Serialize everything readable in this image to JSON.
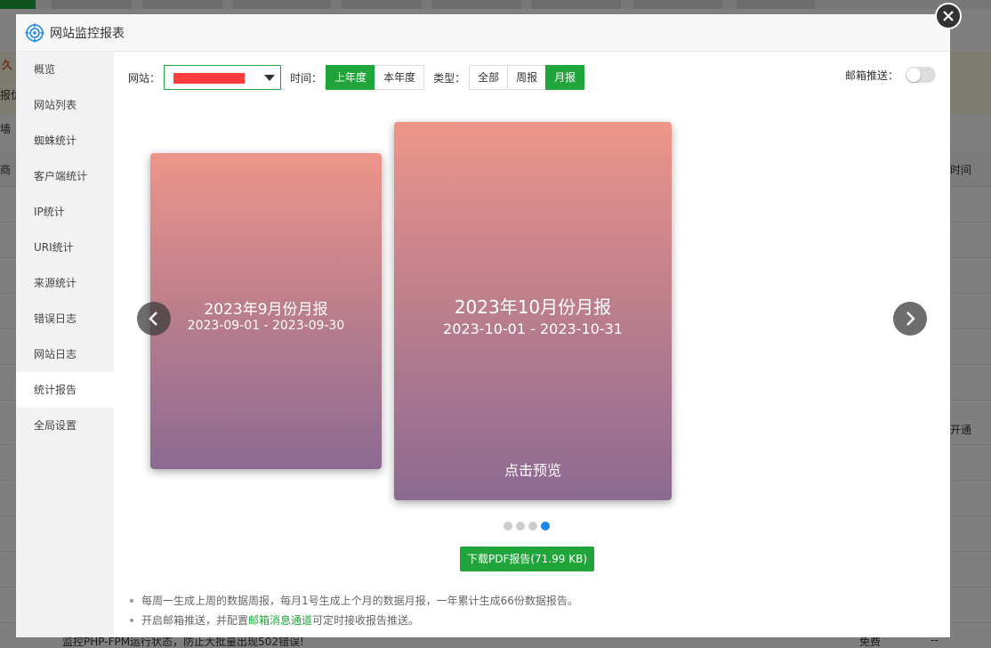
{
  "background": {
    "notice_fragments": [
      "久",
      "报优",
      "墙"
    ],
    "column_fragments": [
      "商",
      "时间"
    ],
    "row_fragments": [
      "开通"
    ],
    "footer_text": "监控PHP-FPM运行状态，防止大批量出现502错误!",
    "footer_price": "免费",
    "footer_dash": "--"
  },
  "modal": {
    "title": "网站监控报表",
    "logo_icon": "crosshair-globe-icon",
    "close_icon": "close-icon"
  },
  "sidebar": {
    "items": [
      {
        "label": "概览"
      },
      {
        "label": "网站列表"
      },
      {
        "label": "蜘蛛统计"
      },
      {
        "label": "客户端统计"
      },
      {
        "label": "IP统计"
      },
      {
        "label": "URI统计"
      },
      {
        "label": "来源统计"
      },
      {
        "label": "错误日志"
      },
      {
        "label": "网站日志"
      },
      {
        "label": "统计报告"
      },
      {
        "label": "全局设置"
      }
    ],
    "active_index": 9
  },
  "toolbar": {
    "site_label": "网站：",
    "time_label": "时间：",
    "time_options": [
      "上年度",
      "本年度"
    ],
    "time_selected": "上年度",
    "type_label": "类型：",
    "type_options": [
      "全部",
      "周报",
      "月报"
    ],
    "type_selected": "月报",
    "email_push_label": "邮箱推送：",
    "email_push_on": false
  },
  "carousel": {
    "prev_card": {
      "title": "2023年9月份月报",
      "range": "2023-09-01 - 2023-09-30"
    },
    "current_card": {
      "title": "2023年10月份月报",
      "range": "2023-10-01 - 2023-10-31",
      "preview_label": "点击预览"
    },
    "dot_count": 4,
    "active_dot": 3,
    "prev_icon": "chevron-left-icon",
    "next_icon": "chevron-right-icon"
  },
  "download": {
    "label": "下载PDF报告(71.99 KB)"
  },
  "tips": {
    "line1": "每周一生成上周的数据周报，每月1号生成上个月的数据月报，一年累计生成66份数据报告。",
    "line2_prefix": "开启邮箱推送，并配置",
    "line2_link": "邮箱消息通道",
    "line2_suffix": "可定时接收报告推送。"
  },
  "colors": {
    "accent": "#20a53a",
    "dot_active": "#1e88e5",
    "redaction": "#ff3b3b",
    "card_top": "#ee958a",
    "card_bottom": "#8c6a92"
  }
}
